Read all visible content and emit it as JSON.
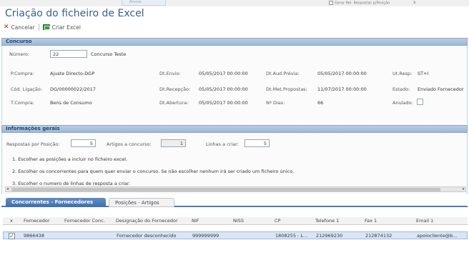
{
  "background": {
    "tab_label": "Árvore",
    "checkbox_label": "Gerar Rel. Respostas p/Posição",
    "close": "x"
  },
  "window_title": "Criação do ficheiro de Excel",
  "toolbar": {
    "cancel_label": "Cancelar",
    "create_label": "Criar Excel"
  },
  "concurso": {
    "header": "Concurso",
    "numero_label": "Número:",
    "numero_value": "22",
    "concurso_name": "Concurso Teste",
    "pcompra_label": "P.Compra:",
    "pcompra_value": "Ajuste Directo-DGP",
    "dtenvio_label": "Dt.Envio:",
    "dtenvio_value": "05/05/2017 00:00:00",
    "dtaud_label": "Dt.Aud.Prévia:",
    "dtaud_value": "05/05/2017 00:00:00",
    "utresp_label": "Ut.Resp:",
    "utresp_value": "ST+I",
    "cod_label": "Cód. Ligação:",
    "cod_value": "DG/00000022/2017",
    "dtrecep_label": "Dt.Recepção:",
    "dtrecep_value": "05/05/2017 00:00:00",
    "dtmet_label": "Dt.Met.Propostas:",
    "dtmet_value": "11/07/2017 00:00:00",
    "estado_label": "Estado:",
    "estado_value": "Enviado Fornecedor",
    "tcompra_label": "T.Compra:",
    "tcompra_value": "Bens de Consumo",
    "dtabert_label": "Dt.Abertura:",
    "dtabert_value": "05/05/2017 00:00:00",
    "ndias_label": "Nº Dias:",
    "ndias_value": "66",
    "anulado_label": "Anulado:"
  },
  "info": {
    "header": "Informações gerais",
    "resp_label": "Respostas por Posição:",
    "resp_value": "5",
    "artigos_label": "Artigos a concurso:",
    "artigos_value": "1",
    "linhas_label": "Linhas a criar:",
    "linhas_value": "5",
    "instr1": "1. Escolher as posições a incluir no ficheiro excel.",
    "instr2": "2. Escolher os concorrentes para quem quer enviar o concurso. Se não escolher nenhum irá ser criado um ficheiro único.",
    "instr3": "3. Escolher o numero de linhas de resposta a criar."
  },
  "tabs": {
    "tab1": "Concorrentes - Fornecedores",
    "tab2": "Posições - Artigos"
  },
  "grid": {
    "headers": [
      "x",
      "Fornecedor",
      "Fornecedor Conc.",
      "Designação do Fornecedor",
      "NIF",
      "NISS",
      "CP",
      "Telefone 1",
      "Fax 1",
      "Email 1"
    ],
    "row": [
      "9866438",
      "",
      "Fornecedor desconhecido",
      "999999999",
      "",
      "1808255 - L...",
      "212969230",
      "212874132",
      "apoiocliente@b..."
    ]
  }
}
